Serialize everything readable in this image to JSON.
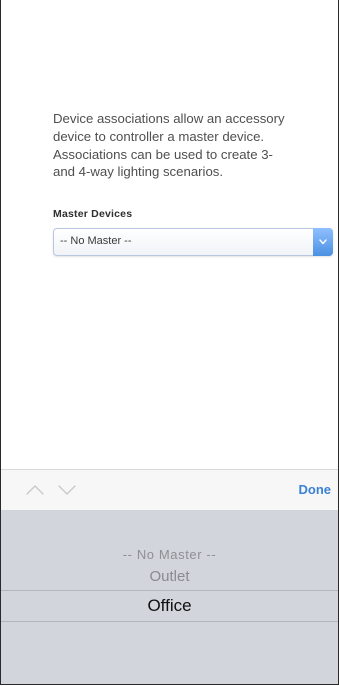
{
  "description": {
    "line1": "Device associations allow an accessory",
    "line2": "device to controller a master device.",
    "line3": "Associations can be used to create 3-",
    "line4": "and 4-way lighting scenarios."
  },
  "master_devices": {
    "label": "Master Devices",
    "selected_value": "-- No Master --"
  },
  "picker_toolbar": {
    "prev_icon": "chevron-up-icon",
    "next_icon": "chevron-down-icon",
    "done_label": "Done"
  },
  "picker": {
    "options": [
      "-- No Master --",
      "Outlet",
      "Office"
    ],
    "selected": "Office"
  },
  "colors": {
    "accent": "#3b82d6",
    "picker_bg": "#d2d5db",
    "select_arrow": "#4a90e2"
  }
}
